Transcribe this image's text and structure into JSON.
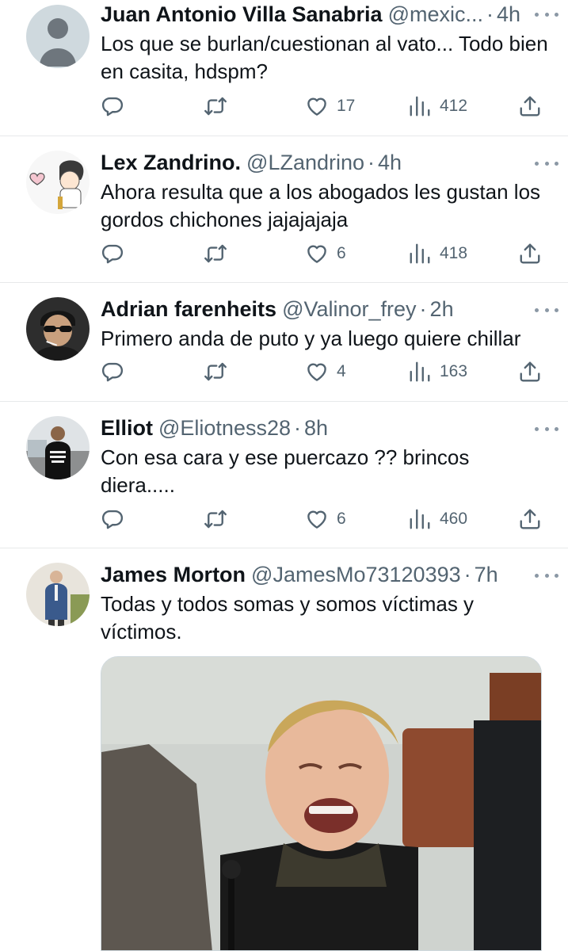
{
  "tweets": [
    {
      "name": "Juan Antonio Villa Sanabria",
      "handle": "@mexic...",
      "time": "4h",
      "text": "Los que se burlan/cuestionan al vato... Todo bien en casita, hdspm?",
      "likes": "17",
      "views": "412"
    },
    {
      "name": "Lex Zandrino.",
      "handle": "@LZandrino",
      "time": "4h",
      "text": "Ahora resulta que a los abogados les gustan los gordos chichones jajajajaja",
      "likes": "6",
      "views": "418"
    },
    {
      "name": "Adrian farenheits",
      "handle": "@Valinor_frey",
      "time": "2h",
      "text": "Primero anda de puto y ya luego quiere chillar",
      "likes": "4",
      "views": "163"
    },
    {
      "name": "Elliot",
      "handle": "@Eliotness28",
      "time": "8h",
      "text": "Con esa cara y ese puercazo ?? brincos diera.....",
      "likes": "6",
      "views": "460"
    },
    {
      "name": "James Morton",
      "handle": "@JamesMo73120393",
      "time": "7h",
      "text": "Todas y todos somas y somos víctimas y víctimos."
    }
  ],
  "separator": "·",
  "icons": {
    "reply": "reply-icon",
    "retweet": "retweet-icon",
    "like": "heart-icon",
    "views": "views-bar-icon",
    "share": "share-icon",
    "more": "more-options-icon"
  },
  "colors": {
    "text": "#0f1419",
    "secondary": "#536471",
    "divider": "#e7e9ea"
  }
}
